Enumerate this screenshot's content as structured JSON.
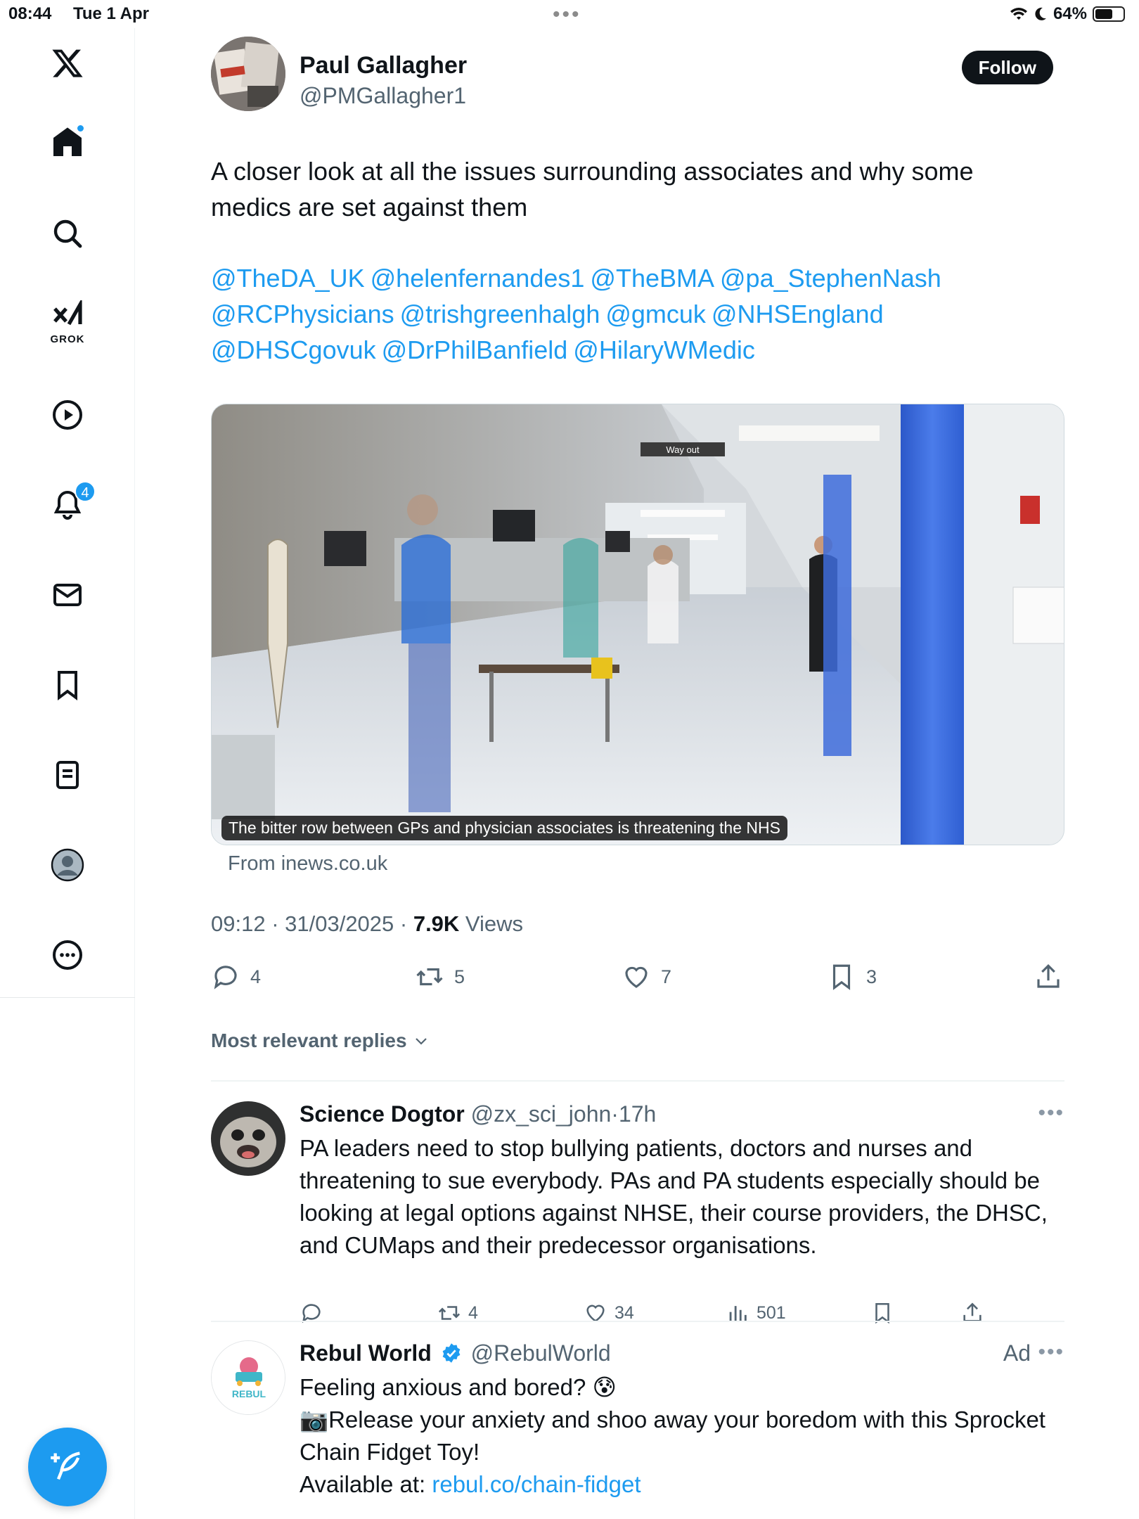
{
  "status_bar": {
    "time": "08:44",
    "date": "Tue 1 Apr",
    "battery": "64%",
    "battery_level": 0.64
  },
  "sidebar": {
    "grok_label": "GROK",
    "notifications_badge": "4"
  },
  "tweet": {
    "author_name": "Paul Gallagher",
    "author_handle": "@PMGallagher1",
    "follow_label": "Follow",
    "text": "A closer look at all the issues surrounding associates and why some medics are set against them",
    "mentions": [
      "@TheDA_UK",
      "@helenfernandes1",
      "@TheBMA",
      "@pa_StephenNash",
      "@RCPhysicians",
      "@trishgreenhalgh",
      "@gmcuk",
      "@NHSEngland",
      "@DHSCgovuk",
      "@DrPhilBanfield",
      "@HilaryWMedic"
    ],
    "card_caption": "The bitter row between GPs and physician associates is threatening the NHS",
    "card_source": "From inews.co.uk",
    "image_sign": "Way out",
    "timestamp": "09:12 · 31/03/2025 · ",
    "views_count": "7.9K",
    "views_label": " Views",
    "replies": "4",
    "reposts": "5",
    "likes": "7",
    "bookmarks": "3"
  },
  "replies_sort_label": "Most relevant replies",
  "replies": [
    {
      "name": "Science Dogtor",
      "handle": "@zx_sci_john",
      "time": "17h",
      "text": "PA leaders need to stop bullying patients, doctors and nurses and threatening to sue everybody. PAs and PA students especially should be looking at legal options against NHSE, their course providers, the DHSC, and CUMaps and their predecessor organisations.",
      "replies": "",
      "reposts": "4",
      "likes": "34",
      "views": "501"
    },
    {
      "name": "Rebul World",
      "handle": "@RebulWorld",
      "ad_label": "Ad",
      "line1": "Feeling anxious and bored? 😰",
      "line2": "📷Release your anxiety and shoo away your boredom with this Sprocket Chain Fidget Toy!",
      "line3_prefix": "Available at: ",
      "line3_link": "rebul.co/chain-fidget",
      "logo_text": "REBUL"
    }
  ],
  "colors": {
    "accent": "#1d9bf0",
    "text": "#0f1419",
    "muted": "#536471"
  }
}
